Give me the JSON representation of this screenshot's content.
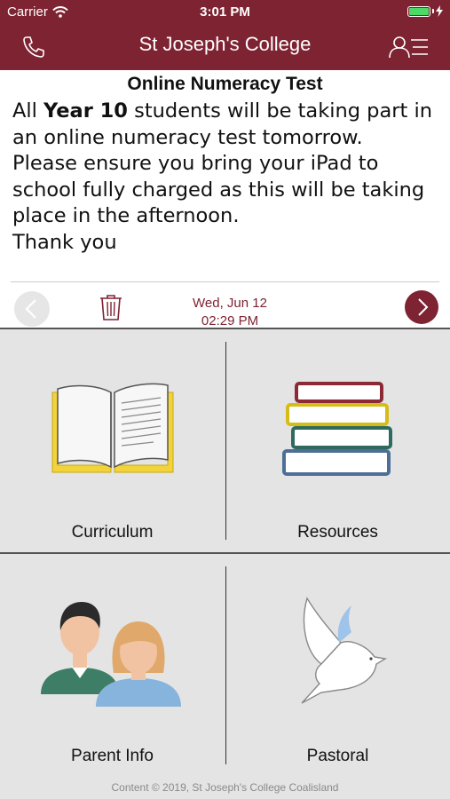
{
  "status_bar": {
    "carrier": "Carrier",
    "time": "3:01 PM"
  },
  "nav": {
    "title": "St Joseph's College"
  },
  "notice": {
    "title": "Online Numeracy Test",
    "body_prefix": "All ",
    "body_bold": "Year 10",
    "body_rest": " students will be taking part in an online numeracy test tomorrow.\nPlease ensure you bring your iPad to school fully charged as this will be taking place in the afternoon.\nThank you",
    "date": "Wed, Jun 12",
    "time": "02:29 PM"
  },
  "tiles": [
    {
      "label": "Curriculum",
      "icon": "open-book-icon"
    },
    {
      "label": "Resources",
      "icon": "book-stack-icon"
    },
    {
      "label": "Parent Info",
      "icon": "parents-icon"
    },
    {
      "label": "Pastoral",
      "icon": "dove-icon"
    }
  ],
  "footer": "Content © 2019, St Joseph's College Coalisland",
  "colors": {
    "brand": "#7e2332",
    "background": "#e4e4e4",
    "battery": "#4cd964"
  }
}
